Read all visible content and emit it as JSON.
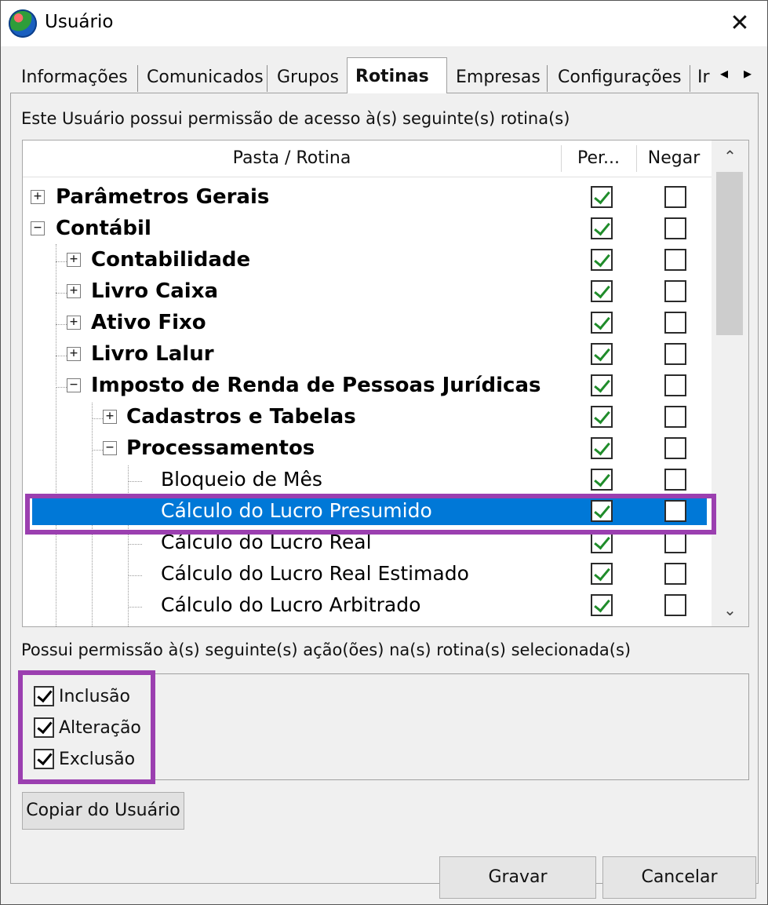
{
  "window": {
    "title": "Usuário",
    "close_glyph": "✕",
    "icon": "app-globe-icon"
  },
  "tabs": [
    {
      "label": "Informações",
      "active": false
    },
    {
      "label": "Comunicados",
      "active": false
    },
    {
      "label": "Grupos",
      "active": false
    },
    {
      "label": "Rotinas",
      "active": true
    },
    {
      "label": "Empresas",
      "active": false
    },
    {
      "label": "Configurações",
      "active": false
    },
    {
      "label": "Ir",
      "active": false
    }
  ],
  "tab_scroll": {
    "left": "◂",
    "right": "▸"
  },
  "routines_caption": "Este Usuário possui permissão de acesso à(s) seguinte(s) rotina(s)",
  "tree": {
    "columns": {
      "folder": "Pasta / Rotina",
      "permit": "Per...",
      "deny": "Negar"
    },
    "scroll_up": "⌃",
    "scroll_down": "⌄",
    "rows": [
      {
        "label": "Parâmetros Gerais",
        "expander": "+",
        "permit": true,
        "deny": false,
        "selected": false
      },
      {
        "label": "Contábil",
        "expander": "−",
        "permit": true,
        "deny": false,
        "selected": false
      },
      {
        "label": "Contabilidade",
        "expander": "+",
        "permit": true,
        "deny": false,
        "selected": false
      },
      {
        "label": "Livro Caixa",
        "expander": "+",
        "permit": true,
        "deny": false,
        "selected": false
      },
      {
        "label": "Ativo Fixo",
        "expander": "+",
        "permit": true,
        "deny": false,
        "selected": false
      },
      {
        "label": "Livro Lalur",
        "expander": "+",
        "permit": true,
        "deny": false,
        "selected": false
      },
      {
        "label": "Imposto de Renda de Pessoas Jurídicas",
        "expander": "−",
        "permit": true,
        "deny": false,
        "selected": false
      },
      {
        "label": "Cadastros e Tabelas",
        "expander": "+",
        "permit": true,
        "deny": false,
        "selected": false
      },
      {
        "label": "Processamentos",
        "expander": "−",
        "permit": true,
        "deny": false,
        "selected": false
      },
      {
        "label": "Bloqueio de Mês",
        "expander": "",
        "permit": true,
        "deny": false,
        "selected": false
      },
      {
        "label": "Cálculo do Lucro Presumido",
        "expander": "",
        "permit": true,
        "deny": false,
        "selected": true
      },
      {
        "label": "Cálculo do Lucro Real",
        "expander": "",
        "permit": true,
        "deny": false,
        "selected": false
      },
      {
        "label": "Cálculo do Lucro Real Estimado",
        "expander": "",
        "permit": true,
        "deny": false,
        "selected": false
      },
      {
        "label": "Cálculo do Lucro Arbitrado",
        "expander": "",
        "permit": true,
        "deny": false,
        "selected": false
      }
    ]
  },
  "actions_caption": "Possui permissão à(s) seguinte(s) ação(ões) na(s) rotina(s) selecionada(s)",
  "actions": [
    {
      "label": "Inclusão",
      "checked": true
    },
    {
      "label": "Alteração",
      "checked": true
    },
    {
      "label": "Exclusão",
      "checked": true
    }
  ],
  "buttons": {
    "copy": "Copiar do Usuário",
    "save": "Gravar",
    "cancel": "Cancelar"
  },
  "colors": {
    "selection": "#0078d7",
    "annotation": "#9b3fb0",
    "check": "#1f8c2a"
  }
}
